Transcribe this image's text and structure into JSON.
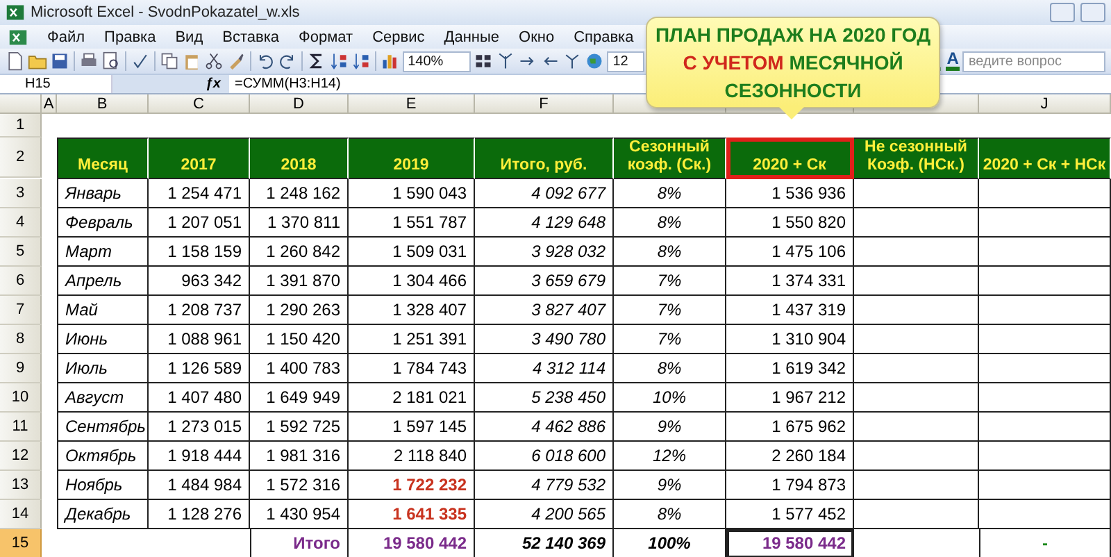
{
  "window": {
    "title": "Microsoft Excel - SvodnPokazatel_w.xls"
  },
  "menu": [
    "Файл",
    "Правка",
    "Вид",
    "Вставка",
    "Формат",
    "Сервис",
    "Данные",
    "Окно",
    "Справка"
  ],
  "toolbar": {
    "zoom": "140%",
    "font_size": "12",
    "help_placeholder": "ведите вопрос",
    "font_color_label": "A"
  },
  "formula_bar": {
    "cell": "H15",
    "function_label": "ƒx",
    "formula": "=СУММ(H3:H14)"
  },
  "column_headers": [
    "A",
    "B",
    "C",
    "D",
    "E",
    "F"
  ],
  "column_headers_right": [
    "J"
  ],
  "callout": {
    "parts": [
      {
        "text": "ПЛАН ПРОДАЖ НА 2020 ГОД",
        "accent": false
      },
      {
        "text": "С УЧЕТОМ",
        "accent": true
      },
      {
        "text": "МЕСЯЧНОЙ СЕЗОННОСТИ",
        "accent": false
      }
    ]
  },
  "header_rows": [
    "1",
    "2"
  ],
  "table_header": [
    {
      "label": "Месяц",
      "outlined": false
    },
    {
      "label": "2017",
      "outlined": false
    },
    {
      "label": "2018",
      "outlined": false
    },
    {
      "label": "2019",
      "outlined": false
    },
    {
      "label": "Итого, руб.",
      "outlined": false
    },
    {
      "label": "Сезонный коэф. (Ск.)",
      "outlined": false
    },
    {
      "label": "2020 + Ск",
      "outlined": true
    },
    {
      "label": "Не сезонный Коэф. (НСк.)",
      "outlined": false
    },
    {
      "label": "2020 + Ск + НСк",
      "outlined": false
    }
  ],
  "rows": [
    {
      "number": "3",
      "selected": false,
      "flagged": false,
      "month": "Январь",
      "values": [
        "1 254 471",
        "1 248 162",
        "1 590 043",
        "4 092 677",
        "8%",
        "1 536 936"
      ]
    },
    {
      "number": "4",
      "selected": false,
      "flagged": false,
      "month": "Февраль",
      "values": [
        "1 207 051",
        "1 370 811",
        "1 551 787",
        "4 129 648",
        "8%",
        "1 550 820"
      ]
    },
    {
      "number": "5",
      "selected": false,
      "flagged": false,
      "month": "Март",
      "values": [
        "1 158 159",
        "1 260 842",
        "1 509 031",
        "3 928 032",
        "8%",
        "1 475 106"
      ]
    },
    {
      "number": "6",
      "selected": false,
      "flagged": false,
      "month": "Апрель",
      "values": [
        "963 342",
        "1 391 870",
        "1 304 466",
        "3 659 679",
        "7%",
        "1 374 331"
      ]
    },
    {
      "number": "7",
      "selected": false,
      "flagged": false,
      "month": "Май",
      "values": [
        "1 208 737",
        "1 290 263",
        "1 328 407",
        "3 827 407",
        "7%",
        "1 437 319"
      ]
    },
    {
      "number": "8",
      "selected": false,
      "flagged": false,
      "month": "Июнь",
      "values": [
        "1 088 961",
        "1 150 420",
        "1 251 391",
        "3 490 780",
        "7%",
        "1 310 904"
      ]
    },
    {
      "number": "9",
      "selected": false,
      "flagged": false,
      "month": "Июль",
      "values": [
        "1 126 589",
        "1 400 783",
        "1 784 743",
        "4 312 114",
        "8%",
        "1 619 342"
      ]
    },
    {
      "number": "10",
      "selected": false,
      "flagged": false,
      "month": "Август",
      "values": [
        "1 407 480",
        "1 649 949",
        "2 181 021",
        "5 238 450",
        "10%",
        "1 967 212"
      ]
    },
    {
      "number": "11",
      "selected": false,
      "flagged": false,
      "month": "Сентябрь",
      "values": [
        "1 273 015",
        "1 592 725",
        "1 597 145",
        "4 462 886",
        "9%",
        "1 675 962"
      ]
    },
    {
      "number": "12",
      "selected": false,
      "flagged": false,
      "month": "Октябрь",
      "values": [
        "1 918 444",
        "1 981 316",
        "2 118 840",
        "6 018 600",
        "12%",
        "2 260 184"
      ]
    },
    {
      "number": "13",
      "selected": false,
      "flagged": true,
      "month": "Ноябрь",
      "values": [
        "1 484 984",
        "1 572 316",
        "1 722 232",
        "4 779 532",
        "9%",
        "1 794 873"
      ]
    },
    {
      "number": "14",
      "selected": false,
      "flagged": true,
      "month": "Декабрь",
      "values": [
        "1 128 276",
        "1 430 954",
        "1 641 335",
        "4 200 565",
        "8%",
        "1 577 452"
      ]
    }
  ],
  "total_row": {
    "number": "15",
    "selected": true,
    "label": "Итого",
    "sum_2019": "19 580 442",
    "sum_total": "52 140 369",
    "sum_coef": "100%",
    "sum_plan": "19 580 442",
    "extra": "-"
  }
}
